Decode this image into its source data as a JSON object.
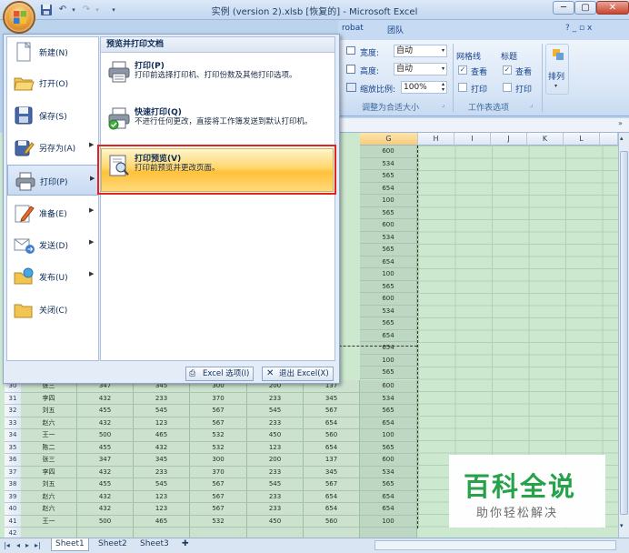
{
  "window": {
    "title": "实例 (version 2).xlsb [恢复的] - Microsoft Excel",
    "minimize": "─",
    "maximize": "▢",
    "close": "✕"
  },
  "ribbon": {
    "tabs": [
      "robat",
      "团队"
    ],
    "help_icons": "? _ ▫ x",
    "width_label": "宽度:",
    "width_value": "自动",
    "height_label": "高度:",
    "height_value": "自动",
    "scale_label": "缩放比例:",
    "scale_value": "100%",
    "group_fit": "调整为合适大小",
    "gridlines_label": "网格线",
    "headings_label": "标题",
    "view_label": "查看",
    "print_label": "打印",
    "group_sheet_options": "工作表选项",
    "arrange_label": "排列"
  },
  "columns": [
    "G",
    "H",
    "I",
    "J",
    "K",
    "L"
  ],
  "column_g_values": [
    "600",
    "534",
    "565",
    "654",
    "100",
    "565",
    "600",
    "534",
    "565",
    "654",
    "100",
    "565",
    "600",
    "534",
    "565",
    "654",
    "654",
    "100",
    "565"
  ],
  "bottom_rows": [
    {
      "num": "30",
      "cells": [
        "张三",
        "347",
        "345",
        "300",
        "200",
        "137",
        "600"
      ]
    },
    {
      "num": "31",
      "cells": [
        "李四",
        "432",
        "233",
        "370",
        "233",
        "345",
        "534"
      ]
    },
    {
      "num": "32",
      "cells": [
        "刘五",
        "455",
        "545",
        "567",
        "545",
        "567",
        "565"
      ]
    },
    {
      "num": "33",
      "cells": [
        "赵六",
        "432",
        "123",
        "567",
        "233",
        "654",
        "654"
      ]
    },
    {
      "num": "34",
      "cells": [
        "王一",
        "500",
        "465",
        "532",
        "450",
        "560",
        "100"
      ]
    },
    {
      "num": "35",
      "cells": [
        "陈二",
        "455",
        "432",
        "532",
        "123",
        "654",
        "565"
      ]
    },
    {
      "num": "36",
      "cells": [
        "张三",
        "347",
        "345",
        "300",
        "200",
        "137",
        "600"
      ]
    },
    {
      "num": "37",
      "cells": [
        "李四",
        "432",
        "233",
        "370",
        "233",
        "345",
        "534"
      ]
    },
    {
      "num": "38",
      "cells": [
        "刘五",
        "455",
        "545",
        "567",
        "545",
        "567",
        "565"
      ]
    },
    {
      "num": "39",
      "cells": [
        "赵六",
        "432",
        "123",
        "567",
        "233",
        "654",
        "654"
      ]
    },
    {
      "num": "40",
      "cells": [
        "赵六",
        "432",
        "123",
        "567",
        "233",
        "654",
        "654"
      ]
    },
    {
      "num": "41",
      "cells": [
        "王一",
        "500",
        "465",
        "532",
        "450",
        "560",
        "100"
      ]
    },
    {
      "num": "42",
      "cells": [
        "",
        "",
        "",
        "",
        "",
        "",
        ""
      ]
    }
  ],
  "sheet_tabs": [
    "Sheet1",
    "Sheet2",
    "Sheet3"
  ],
  "office_menu": {
    "left_items": [
      {
        "label": "新建(N)",
        "icon": "new-document-icon",
        "has_arrow": false
      },
      {
        "label": "打开(O)",
        "icon": "open-folder-icon",
        "has_arrow": false
      },
      {
        "label": "保存(S)",
        "icon": "save-disk-icon",
        "has_arrow": false
      },
      {
        "label": "另存为(A)",
        "icon": "save-as-icon",
        "has_arrow": true
      },
      {
        "label": "打印(P)",
        "icon": "printer-icon",
        "has_arrow": true
      },
      {
        "label": "准备(E)",
        "icon": "prepare-pen-icon",
        "has_arrow": true
      },
      {
        "label": "发送(D)",
        "icon": "send-icon",
        "has_arrow": true
      },
      {
        "label": "发布(U)",
        "icon": "publish-icon",
        "has_arrow": true
      },
      {
        "label": "关闭(C)",
        "icon": "close-folder-icon",
        "has_arrow": false
      }
    ],
    "right_header": "预览并打印文档",
    "print_options": [
      {
        "title": "打印(P)",
        "desc": "打印前选择打印机、打印份数及其他打印选项。",
        "icon": "printer-icon"
      },
      {
        "title": "快速打印(Q)",
        "desc": "不进行任何更改，直接将工作簿发送到默认打印机。",
        "icon": "quick-print-icon"
      },
      {
        "title": "打印预览(V)",
        "desc": "打印前预览并更改页面。",
        "icon": "print-preview-icon"
      }
    ],
    "excel_options": "Excel 选项(I)",
    "exit_excel": "退出 Excel(X)"
  },
  "watermark": {
    "title": "百科全说",
    "subtitle": "助你轻松解决"
  },
  "colors": {
    "menu_highlight": "#ffd66b",
    "red_frame": "#e02424",
    "watermark_green": "#25a24a"
  }
}
